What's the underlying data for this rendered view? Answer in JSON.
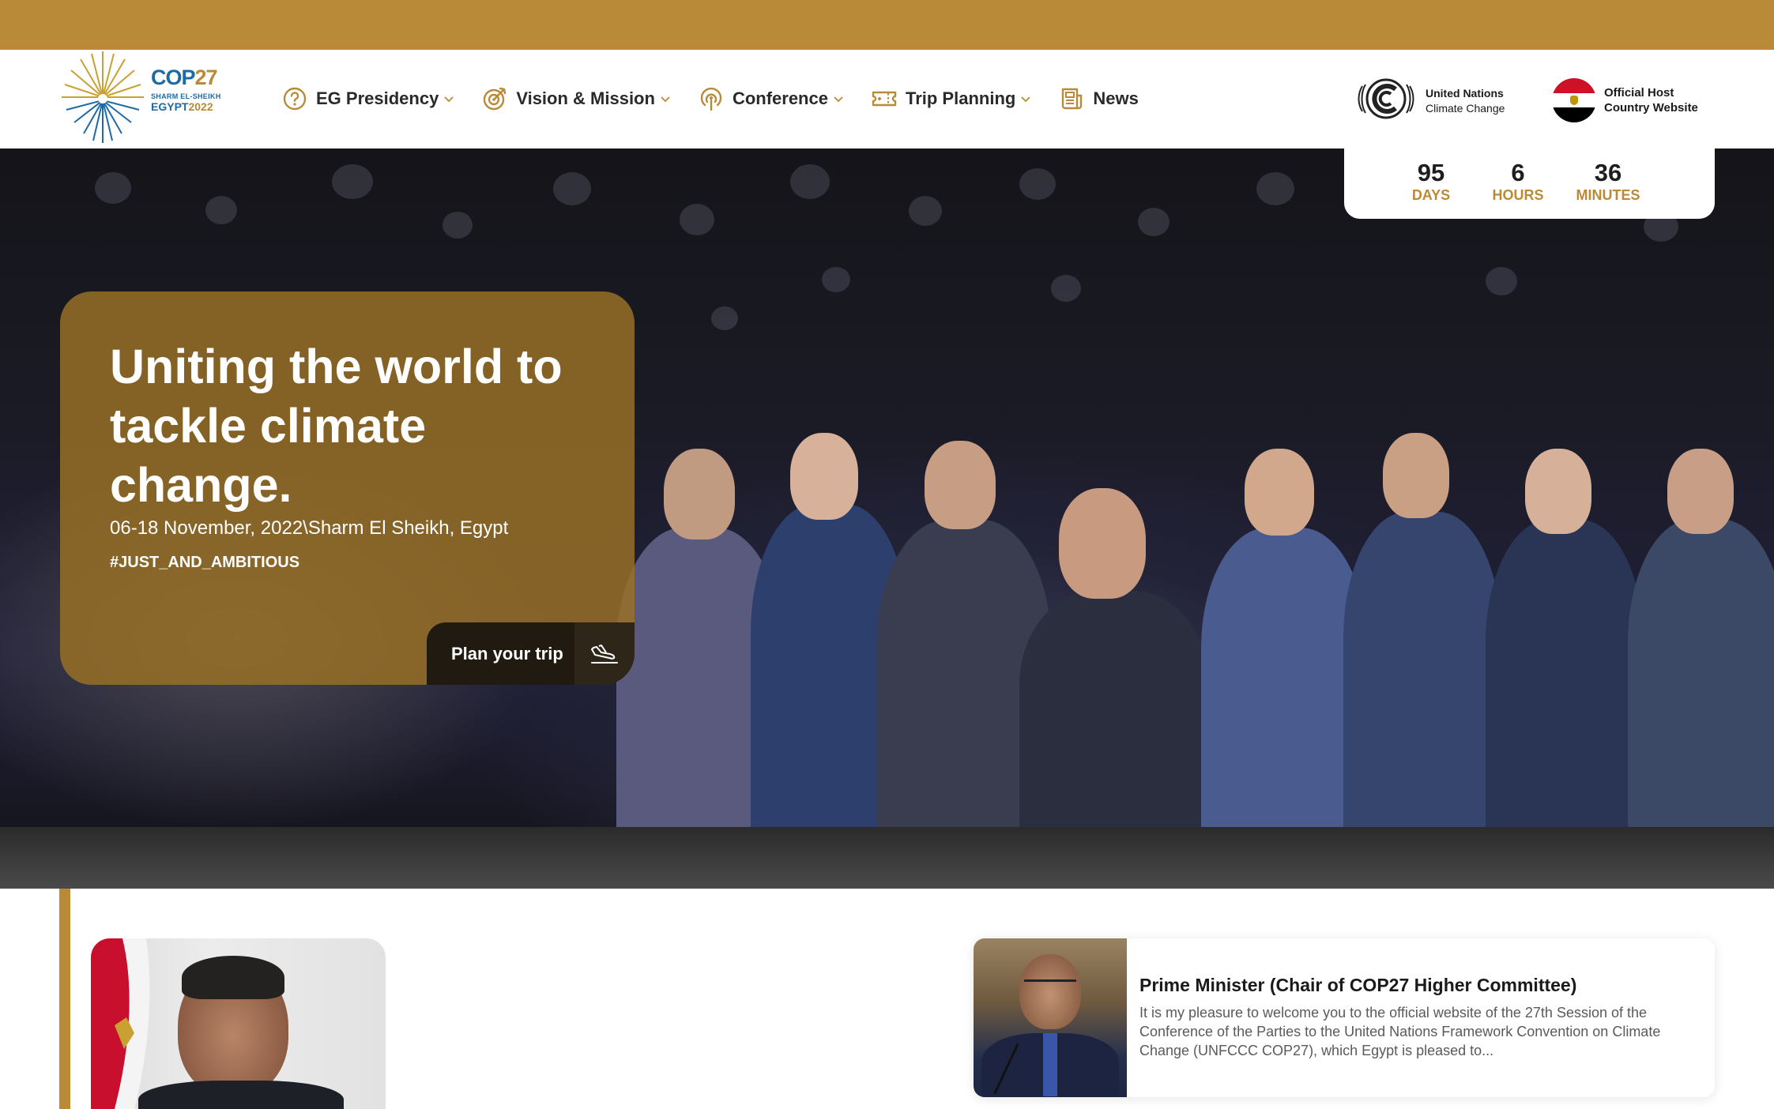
{
  "logo": {
    "cop": "COP",
    "num": "27",
    "sub1": "SHARM EL-SHEIKH",
    "sub2_country": "EGYPT",
    "sub2_year": "2022"
  },
  "nav": {
    "items": [
      {
        "label": "EG Presidency",
        "icon": "question-circle-icon",
        "has_dropdown": true
      },
      {
        "label": "Vision & Mission",
        "icon": "target-icon",
        "has_dropdown": true
      },
      {
        "label": "Conference",
        "icon": "podcast-icon",
        "has_dropdown": true
      },
      {
        "label": "Trip Planning",
        "icon": "ticket-icon",
        "has_dropdown": true
      },
      {
        "label": "News",
        "icon": "newspaper-icon",
        "has_dropdown": false
      }
    ]
  },
  "partners": {
    "unfccc_line1": "United Nations",
    "unfccc_line2": "Climate Change",
    "host_line1": "Official Host",
    "host_line2": "Country Website"
  },
  "countdown": {
    "days": "95",
    "days_label": "DAYS",
    "hours": "6",
    "hours_label": "HOURS",
    "minutes": "36",
    "minutes_label": "MINUTES"
  },
  "hero": {
    "title": "Uniting the world to tackle climate change.",
    "date_location": "06-18 November, 2022\\Sharm El Sheikh, Egypt",
    "hashtag": "#JUST_AND_AMBITIOUS",
    "cta_label": "Plan your trip"
  },
  "pm_card": {
    "title": "Prime Minister (Chair of COP27 Higher Committee)",
    "excerpt": "It is my pleasure to welcome you to the official website of the 27th Session of the Conference of the Parties to the United Nations Framework Convention on Climate Change (UNFCCC COP27), which Egypt is pleased to..."
  },
  "colors": {
    "accent_gold": "#b98a37",
    "hero_card": "#966f26",
    "brand_blue": "#1d6aa5",
    "dark_button": "#201a10"
  }
}
